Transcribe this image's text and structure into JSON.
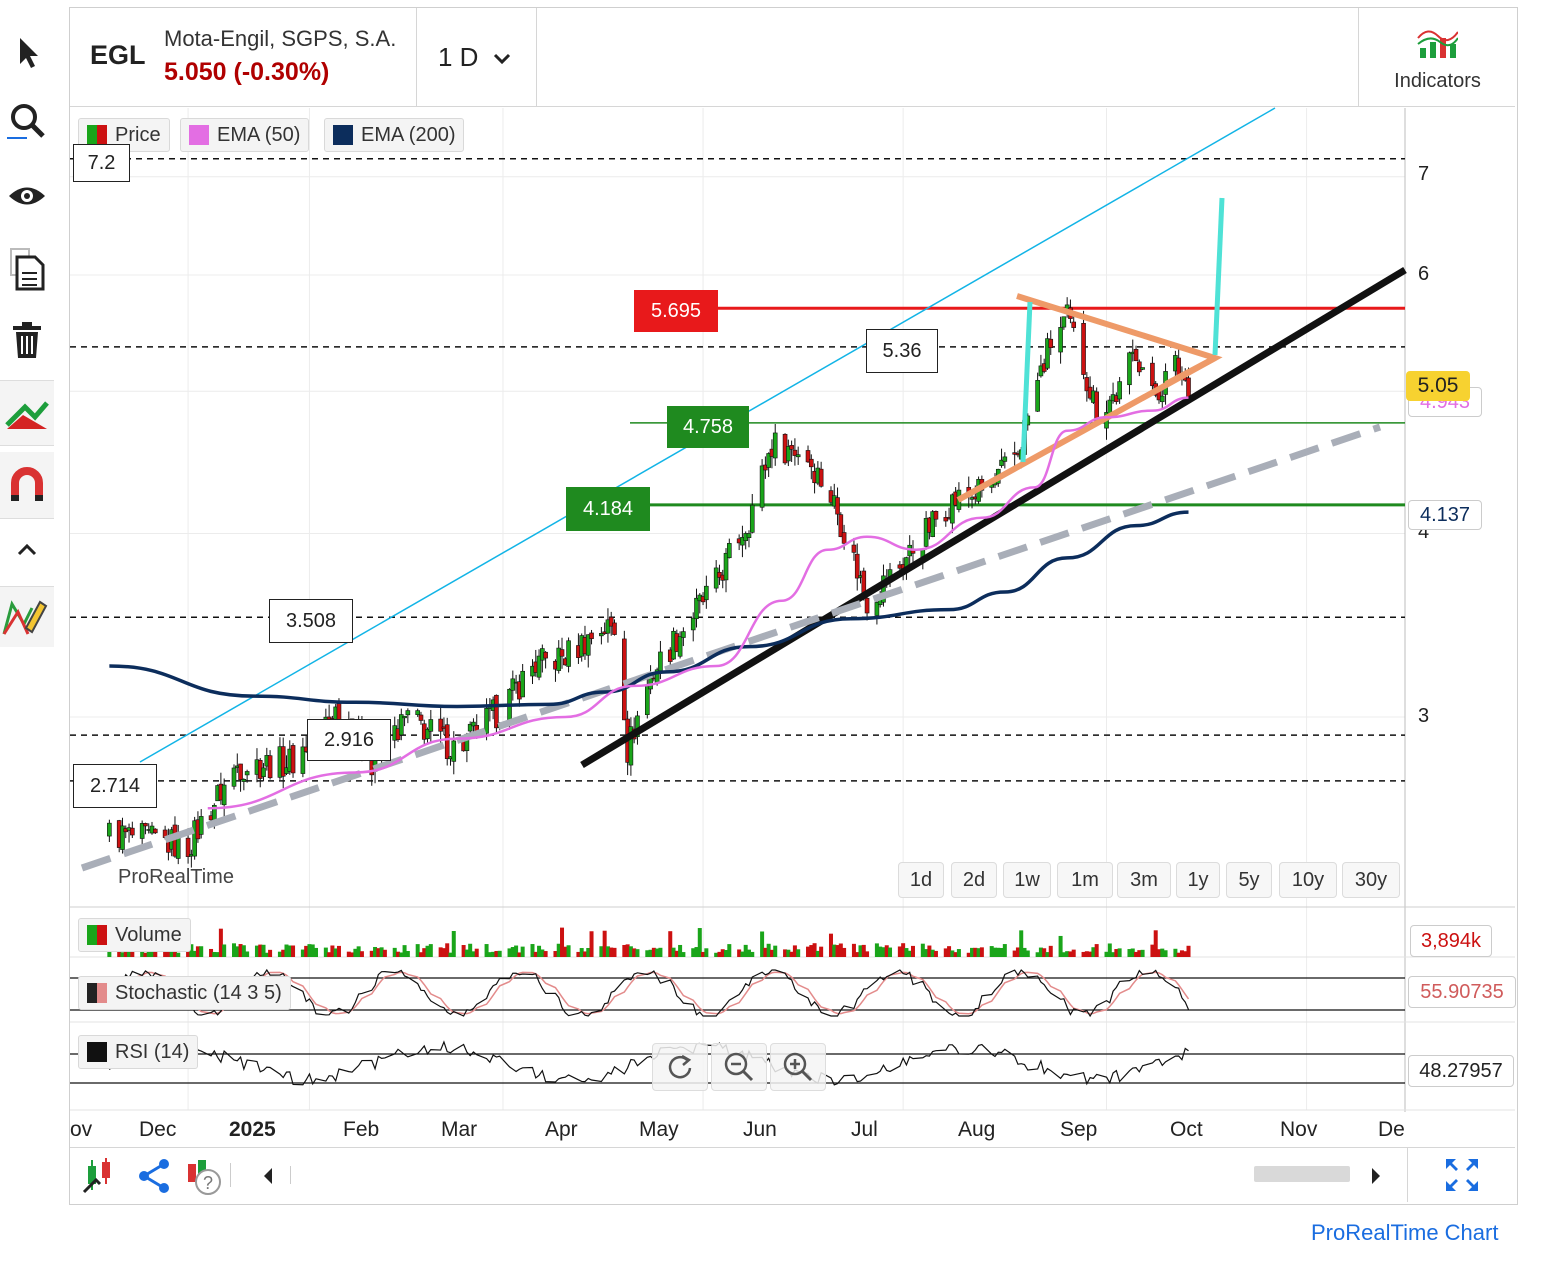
{
  "symbol": {
    "ticker": "EGL",
    "name": "Mota-Engil, SGPS, S.A.",
    "price_text": "5.050 (-0.30%)",
    "timeframe": "1 D",
    "indicators_label": "Indicators"
  },
  "legend": {
    "price": "Price",
    "ema50": "EMA (50)",
    "ema200": "EMA (200)",
    "volume": "Volume",
    "stochastic": "Stochastic (14 3 5)",
    "rsi": "RSI (14)"
  },
  "watermark": "ProRealTime",
  "footer_link": "ProRealTime Chart",
  "ranges": [
    "1d",
    "2d",
    "1w",
    "1m",
    "3m",
    "1y",
    "5y",
    "10y",
    "30y"
  ],
  "months": [
    "ov",
    "Dec",
    "2025",
    "Feb",
    "Mar",
    "Apr",
    "May",
    "Jun",
    "Jul",
    "Aug",
    "Sep",
    "Oct",
    "Nov",
    "Dec"
  ],
  "colors": {
    "up": "#1aa51a",
    "down": "#cc1111",
    "ema50": "#e36ee3",
    "ema200": "#0c2d5c",
    "resistance": "#e8191b",
    "support": "#1f8a1f",
    "channel": "#12b4e6",
    "triangle": "#ee9a68",
    "projection": "#4fe2d6",
    "trend": "#111111",
    "dashed_trend": "#a9aeb8"
  },
  "icons": [
    "cursor-icon",
    "zoom-icon",
    "eye-icon",
    "copy-icon",
    "trash-icon",
    "trend-tool-icon",
    "magnet-icon",
    "collapse-icon",
    "drawing-pencil-icon"
  ],
  "chart_data": {
    "type": "candlestick",
    "title": "EGL",
    "y_scale": "log",
    "ylim": [
      2.3,
      7.6
    ],
    "y_ticks": [
      "3",
      "4",
      "6",
      "7"
    ],
    "x_axis": "daily, Nov 2024 – Dec 2025",
    "last_price": "5.05",
    "ema50_label": "4.943",
    "ema200_label": "4.137",
    "levels": [
      {
        "value": 7.2,
        "label": "7.2",
        "style": "dashed"
      },
      {
        "value": 5.695,
        "label": "5.695",
        "style": "resistance"
      },
      {
        "value": 5.36,
        "label": "5.36",
        "style": "dashed"
      },
      {
        "value": 4.758,
        "label": "4.758",
        "style": "support"
      },
      {
        "value": 4.184,
        "label": "4.184",
        "style": "support"
      },
      {
        "value": 3.508,
        "label": "3.508",
        "style": "dashed"
      },
      {
        "value": 2.916,
        "label": "2.916",
        "style": "dashed"
      },
      {
        "value": 2.714,
        "label": "2.714",
        "style": "dashed"
      }
    ],
    "anchors": [
      [
        "2024-11-01",
        2.5
      ],
      [
        "2024-11-25",
        2.45
      ],
      [
        "2024-12-10",
        2.78
      ],
      [
        "2024-12-27",
        2.8
      ],
      [
        "2025-01-10",
        3.05
      ],
      [
        "2025-01-20",
        2.8
      ],
      [
        "2025-01-31",
        3.0
      ],
      [
        "2025-02-15",
        2.85
      ],
      [
        "2025-03-01",
        3.05
      ],
      [
        "2025-03-10",
        3.25
      ],
      [
        "2025-03-20",
        3.3
      ],
      [
        "2025-03-31",
        3.45
      ],
      [
        "2025-04-05",
        3.45
      ],
      [
        "2025-04-08",
        2.85
      ],
      [
        "2025-04-15",
        3.2
      ],
      [
        "2025-04-25",
        3.45
      ],
      [
        "2025-05-05",
        3.7
      ],
      [
        "2025-05-15",
        4.1
      ],
      [
        "2025-05-22",
        4.6
      ],
      [
        "2025-06-01",
        4.55
      ],
      [
        "2025-06-10",
        4.2
      ],
      [
        "2025-06-20",
        3.6
      ],
      [
        "2025-06-30",
        3.8
      ],
      [
        "2025-07-15",
        4.2
      ],
      [
        "2025-07-28",
        4.3
      ],
      [
        "2025-08-05",
        4.55
      ],
      [
        "2025-08-15",
        5.4
      ],
      [
        "2025-08-20",
        5.6
      ],
      [
        "2025-08-25",
        5.2
      ],
      [
        "2025-08-29",
        4.85
      ],
      [
        "2025-09-05",
        5.0
      ],
      [
        "2025-09-10",
        5.35
      ],
      [
        "2025-09-15",
        4.95
      ],
      [
        "2025-09-22",
        5.2
      ],
      [
        "2025-09-26",
        5.05
      ]
    ],
    "ema50": [
      [
        "2024-12-01",
        2.6
      ],
      [
        "2025-01-15",
        2.75
      ],
      [
        "2025-02-15",
        2.9
      ],
      [
        "2025-03-20",
        3.0
      ],
      [
        "2025-04-10",
        3.15
      ],
      [
        "2025-05-05",
        3.25
      ],
      [
        "2025-05-25",
        3.6
      ],
      [
        "2025-06-08",
        3.9
      ],
      [
        "2025-06-20",
        3.98
      ],
      [
        "2025-07-05",
        3.9
      ],
      [
        "2025-07-25",
        4.1
      ],
      [
        "2025-08-10",
        4.3
      ],
      [
        "2025-08-20",
        4.7
      ],
      [
        "2025-09-01",
        4.8
      ],
      [
        "2025-09-15",
        4.85
      ],
      [
        "2025-09-26",
        4.95
      ]
    ],
    "ema200": [
      [
        "2024-11-01",
        3.25
      ],
      [
        "2024-12-15",
        3.1
      ],
      [
        "2025-01-15",
        3.07
      ],
      [
        "2025-02-15",
        3.05
      ],
      [
        "2025-03-15",
        3.06
      ],
      [
        "2025-04-01",
        3.12
      ],
      [
        "2025-04-20",
        3.22
      ],
      [
        "2025-05-15",
        3.35
      ],
      [
        "2025-06-15",
        3.5
      ],
      [
        "2025-07-15",
        3.55
      ],
      [
        "2025-08-01",
        3.65
      ],
      [
        "2025-08-20",
        3.85
      ],
      [
        "2025-09-10",
        4.05
      ],
      [
        "2025-09-26",
        4.137
      ]
    ],
    "volume": {
      "last_label": "3,894k"
    },
    "stochastic": {
      "last_label": "55.90735"
    },
    "rsi": {
      "last_label": "48.27957"
    }
  }
}
